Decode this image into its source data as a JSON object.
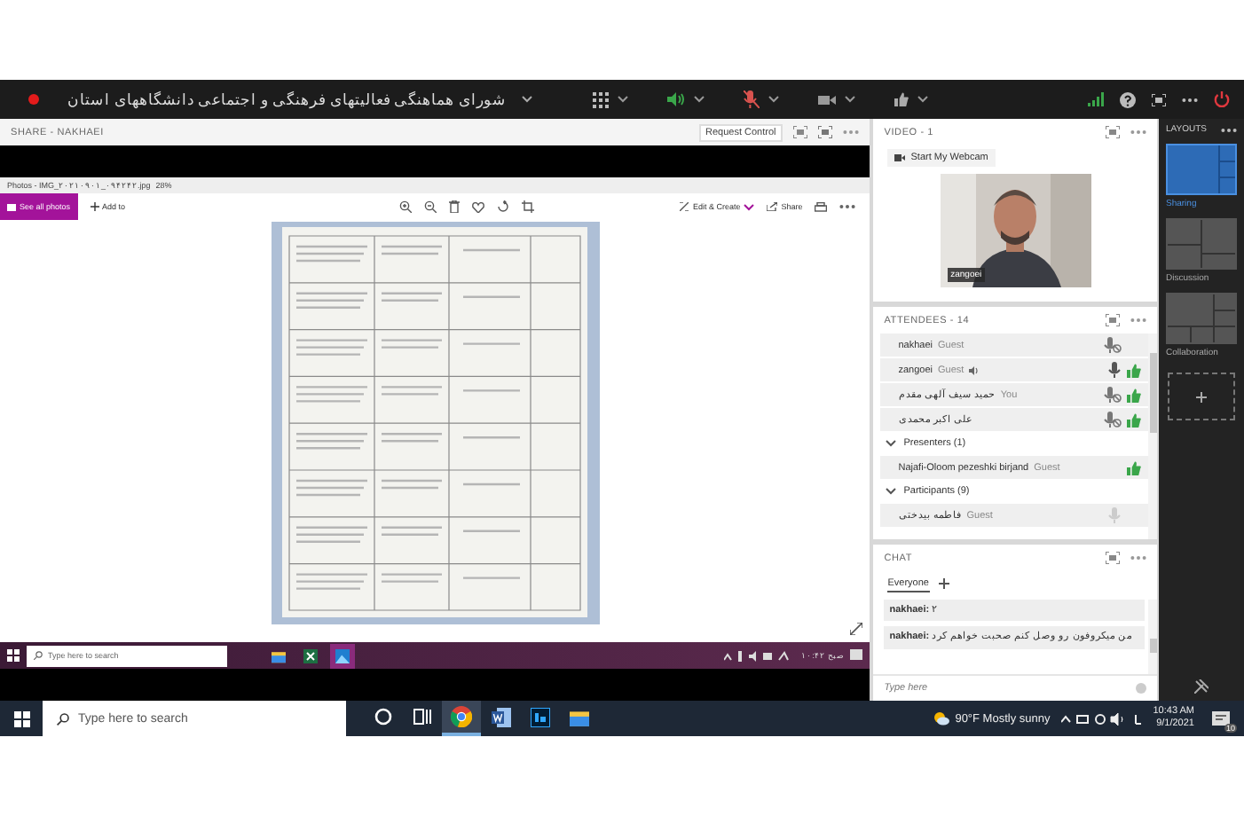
{
  "window": {
    "title": "شورای هماهنگی فعالیتهای فرهنگی و اجتماعی دانشگاههای استان",
    "recording": true,
    "speaker_on": true,
    "mic_muted": true
  },
  "share": {
    "title": "SHARE - NAKHAEI",
    "request_control": "Request Control",
    "photos": {
      "title": "Photos - IMG_۲۰۲۱۰۹۰۱_۰۹۴۲۴۲.jpg",
      "zoom": "28%",
      "see_all": "See all photos",
      "add_to": "Add to",
      "edit_create": "Edit & Create",
      "share": "Share"
    },
    "inner_taskbar": {
      "search_placeholder": "Type here to search",
      "apps": [
        {
          "kind": "explorer",
          "selected": false
        },
        {
          "kind": "excel",
          "selected": false
        },
        {
          "kind": "photos",
          "selected": true
        }
      ],
      "time": "۱۰:۴۲ صبح"
    }
  },
  "video": {
    "title": "VIDEO - 1",
    "webcam_button": "Start My Webcam",
    "feed_label": "zangoei"
  },
  "attendees": {
    "title": "ATTENDEES - 14",
    "people": [
      {
        "name": "nakhaei",
        "role": "Guest",
        "kind": "muted",
        "speaking": false,
        "agree": false
      },
      {
        "name": "zangoei",
        "role": "Guest",
        "kind": "mic",
        "speaking": true,
        "agree": true
      },
      {
        "name": "حمید سیف آلهی مقدم",
        "role": "You",
        "kind": "muted",
        "speaking": false,
        "agree": true
      },
      {
        "name": "علی اکبر محمدی",
        "kind": "muted",
        "speaking": false,
        "agree": true
      }
    ],
    "groups": [
      {
        "label": "Presenters (1)",
        "expanded": true,
        "people": [
          {
            "name": "Najafi-Oloom pezeshki birjand",
            "role": "Guest",
            "kind": "nomic",
            "speaking": false,
            "agree": true
          }
        ]
      },
      {
        "label": "Participants (9)",
        "expanded": true,
        "people": [
          {
            "name": "فاطمه بیدختی",
            "role": "Guest",
            "kind": "greyed",
            "speaking": false,
            "agree": false
          }
        ]
      }
    ]
  },
  "chat": {
    "title": "CHAT",
    "tabs": [
      {
        "label": "Everyone",
        "selected": true
      }
    ],
    "messages": [
      {
        "sender": "nakhaei:",
        "text": "۲"
      },
      {
        "sender": "nakhaei:",
        "text": "من میکروفون رو وصل کنم صحبت خواهم کرد"
      }
    ],
    "placeholder": "Type here"
  },
  "layouts": {
    "title": "LAYOUTS",
    "items": [
      {
        "label": "Sharing",
        "kind": "sharing",
        "selected": true
      },
      {
        "label": "Discussion",
        "kind": "discussion",
        "selected": false
      },
      {
        "label": "Collaboration",
        "kind": "collaboration",
        "selected": false
      }
    ]
  },
  "taskbar": {
    "search_placeholder": "Type here to search",
    "apps": [
      {
        "kind": "cortana",
        "selected": false
      },
      {
        "kind": "taskview",
        "selected": false
      },
      {
        "kind": "chrome",
        "selected": true
      },
      {
        "kind": "word",
        "selected": false
      },
      {
        "kind": "photoshop",
        "selected": false
      },
      {
        "kind": "explorer",
        "selected": false
      }
    ],
    "weather": "90°F Mostly sunny",
    "time": "10:43 AM",
    "date": "9/1/2021",
    "notifications": "10"
  }
}
